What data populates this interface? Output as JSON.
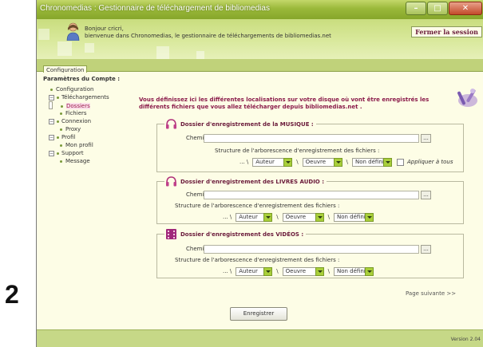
{
  "step_number": "2",
  "window": {
    "title": "Chronomedias : Gestionnaire de téléchargement de bibliomedias"
  },
  "header": {
    "greeting_line1": "Bonjour cricri,",
    "greeting_line2": "bienvenue dans Chronomedias, le gestionnaire de téléchargements de bibliomedias.net",
    "logout_label": "Fermer la session"
  },
  "tabs": [
    {
      "label": "Configuration"
    }
  ],
  "sidebar": {
    "title": "Paramètres du Compte :",
    "tree": [
      {
        "label": "Configuration"
      },
      {
        "label": "Téléchargements"
      },
      {
        "label": "Dossiers",
        "selected": true
      },
      {
        "label": "Fichiers"
      },
      {
        "label": "Connexion"
      },
      {
        "label": "Proxy"
      },
      {
        "label": "Profil"
      },
      {
        "label": "Mon profil"
      },
      {
        "label": "Support"
      },
      {
        "label": "Message"
      }
    ]
  },
  "intro_text": "Vous définissez ici les différentes localisations sur votre disque où vont être enregistrés les différents fichiers que vous allez télécharger depuis bibliomedias.net .",
  "groups": {
    "musique": {
      "title": "Dossier d'enregistrement de la MUSIQUE :",
      "path_label": "Chemin :",
      "path_value": "",
      "structure_label": "Structure de l'arborescence d'enregistrement des fichiers :",
      "prefix": "... \\",
      "separator": "\\",
      "select1": "Auteur",
      "select2": "Oeuvre",
      "select3": "Non défini",
      "apply_label": "Appliquer à tous",
      "browse_label": "..."
    },
    "livres": {
      "title": "Dossier d'enregistrement des LIVRES AUDIO :",
      "path_label": "Chemin :",
      "path_value": "",
      "structure_label": "Structure de l'arborescence d'enregistrement des fichiers :",
      "prefix": "... \\",
      "separator": "\\",
      "select1": "Auteur",
      "select2": "Oeuvre",
      "select3": "Non défini",
      "browse_label": "..."
    },
    "videos": {
      "title": "Dossier d'enregistrement des VIDÉOS :",
      "path_label": "Chemin :",
      "path_value": "",
      "structure_label": "Structure de l'arborescence d'enregistrement des fichiers :",
      "prefix": "... \\",
      "separator": "\\",
      "select1": "Auteur",
      "select2": "Oeuvre",
      "select3": "Non défini",
      "browse_label": "..."
    }
  },
  "next_page_label": "Page suivante >>",
  "save_label": "Enregistrer",
  "version_label": "Version 2.04",
  "icons": {
    "avatar": "user-avatar-icon",
    "musique": "headphones-icon",
    "livres": "headphones-icon",
    "videos": "film-icon",
    "intro": "tools-icon"
  },
  "colors": {
    "accent_green": "#9ab83a",
    "title_red": "#8a1a4a",
    "background": "#fdfde6",
    "dropdown_green": "#a9cf3a"
  }
}
